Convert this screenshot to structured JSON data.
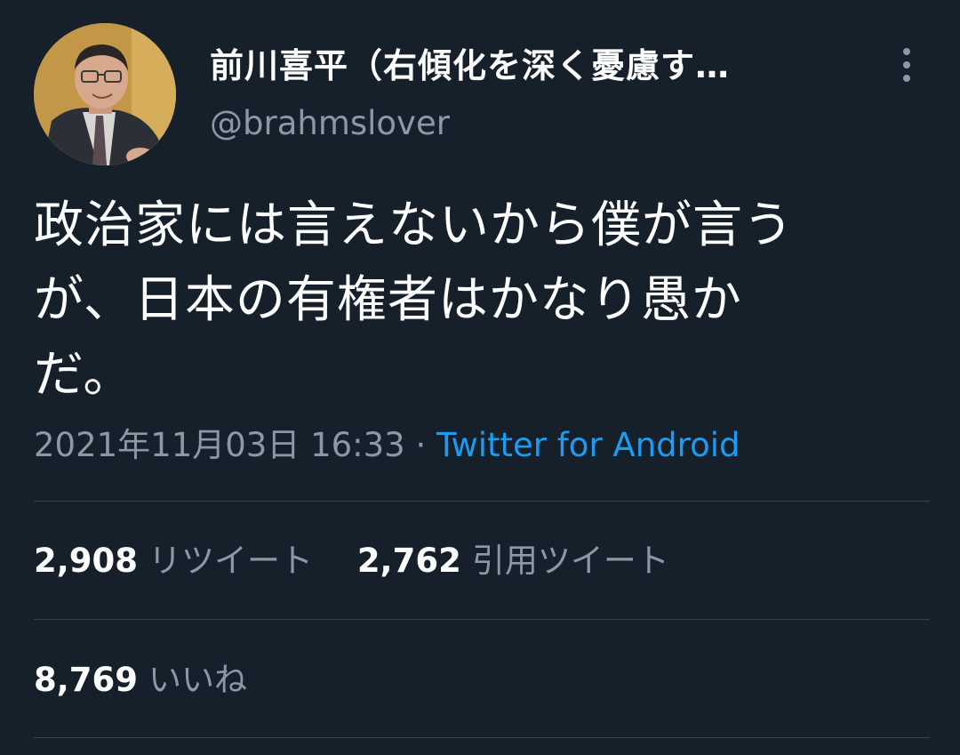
{
  "user": {
    "display_name": "前川喜平（右傾化を深く憂慮す…",
    "handle": "@brahmslover"
  },
  "tweet": {
    "text_lines": [
      "政治家には言えないから僕が言う",
      "が、日本の有権者はかなり愚か",
      "だ。"
    ],
    "timestamp": "2021年11月03日 16:33",
    "separator": "·",
    "source": "Twitter for Android"
  },
  "stats": {
    "retweets_count": "2,908",
    "retweets_label": "リツイート",
    "quotes_count": "2,762",
    "quotes_label": "引用ツイート",
    "likes_count": "8,769",
    "likes_label": "いいね"
  },
  "icons": {
    "more": "more-vertical-icon"
  },
  "colors": {
    "background": "#15202b",
    "accent": "#1d9bf0",
    "secondary_text": "#8b98a5",
    "divider": "#38444d"
  }
}
